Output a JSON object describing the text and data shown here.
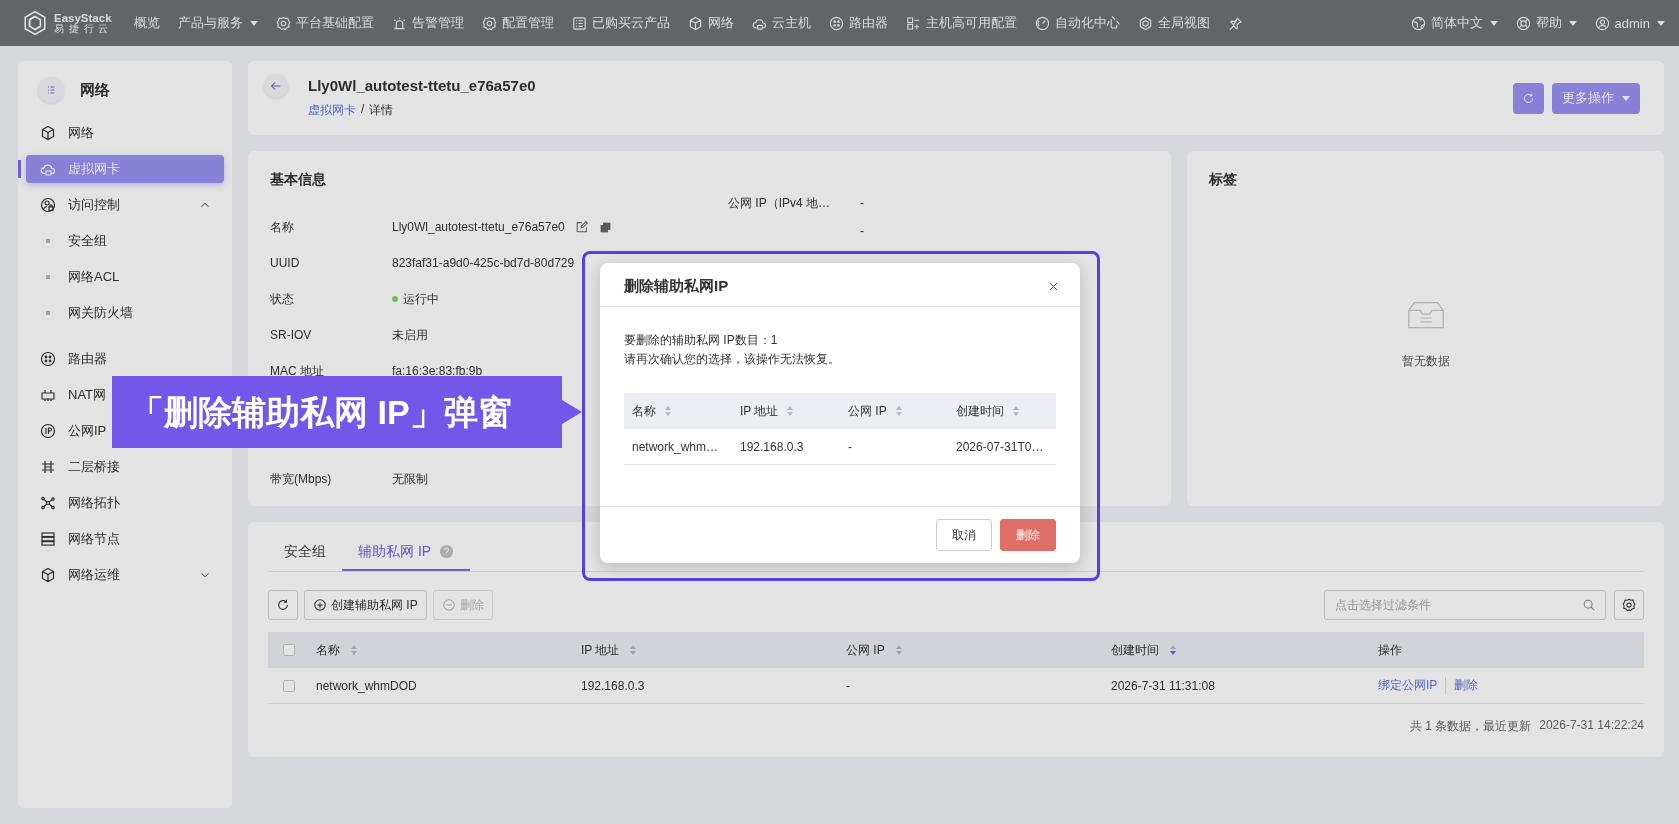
{
  "top_bar": {
    "logo": {
      "name": "EasyStack",
      "subtitle": "易 捷 行 云"
    },
    "nav": [
      {
        "label": "概览",
        "dropdown": false
      },
      {
        "label": "产品与服务",
        "dropdown": true
      },
      {
        "label": "平台基础配置",
        "dropdown": false
      },
      {
        "label": "告警管理",
        "dropdown": false
      },
      {
        "label": "配置管理",
        "dropdown": false
      },
      {
        "label": "已购买云产品",
        "dropdown": false
      },
      {
        "label": "网络",
        "dropdown": false
      },
      {
        "label": "云主机",
        "dropdown": false
      },
      {
        "label": "路由器",
        "dropdown": false
      },
      {
        "label": "主机高可用配置",
        "dropdown": false
      },
      {
        "label": "自动化中心",
        "dropdown": false
      },
      {
        "label": "全局视图",
        "dropdown": false
      }
    ],
    "right": [
      {
        "label": "简体中文",
        "dropdown": true
      },
      {
        "label": "帮助",
        "dropdown": true
      },
      {
        "label": "admin",
        "dropdown": true
      }
    ]
  },
  "sidebar": {
    "title": "网络",
    "items": [
      {
        "label": "网络",
        "selected": false
      },
      {
        "label": "虚拟网卡",
        "selected": true
      },
      {
        "label": "访问控制",
        "selected": false,
        "expanded": true,
        "children": [
          {
            "label": "安全组",
            "selected": false
          },
          {
            "label": "网络ACL",
            "selected": false
          },
          {
            "label": "网关防火墙",
            "selected": false
          }
        ]
      },
      {
        "label": "路由器",
        "selected": false
      },
      {
        "label": "NAT网",
        "selected": false
      },
      {
        "label": "公网IP",
        "selected": false
      },
      {
        "label": "二层桥接",
        "selected": false
      },
      {
        "label": "网络拓扑",
        "selected": false
      },
      {
        "label": "网络节点",
        "selected": false
      },
      {
        "label": "网络运维",
        "selected": false,
        "expanded": false
      }
    ]
  },
  "header": {
    "title": "Lly0Wl_autotest-ttetu_e76a57e0",
    "breadcrumb": [
      {
        "label": "虚拟网卡",
        "link": true
      },
      {
        "label": "详情",
        "link": false
      }
    ],
    "separator": "/",
    "more_button": "更多操作"
  },
  "basic_info": {
    "title": "基本信息",
    "fields": [
      {
        "label": "名称",
        "value": "Lly0Wl_autotest-ttetu_e76a57e0",
        "editable": true,
        "copyable": true
      },
      {
        "label": "UUID",
        "value": "823faf31-a9d0-425c-bd7d-80d729"
      },
      {
        "label": "状态",
        "value": "运行中",
        "color": "#6cc04a"
      },
      {
        "label": "SR-IOV",
        "value": "未启用"
      },
      {
        "label": "MAC 地址",
        "value": "fa:16:3e:83:fb:9b"
      },
      {
        "label": "带宽(Mbps)",
        "value": "无限制"
      }
    ],
    "side_fields": [
      {
        "label": "公网 IP（IPv4 地…",
        "value": "-"
      },
      {
        "value": "-"
      }
    ]
  },
  "tags": {
    "title": "标签",
    "empty_text": "暂无数据"
  },
  "detail_tabs": [
    {
      "label": "安全组",
      "selected": false,
      "help": false
    },
    {
      "label": "辅助私网 IP",
      "selected": true,
      "help": true
    }
  ],
  "toolbar": {
    "buttons": [
      {
        "label": "创建辅助私网 IP",
        "kind": "create",
        "disabled": false
      },
      {
        "label": "删除",
        "kind": "delete",
        "disabled": true
      }
    ],
    "filter_placeholder": "点击选择过滤条件"
  },
  "table": {
    "all_checked": false,
    "columns": [
      {
        "label": "名称",
        "sorted": false
      },
      {
        "label": "IP 地址",
        "sorted": false
      },
      {
        "label": "公网 IP",
        "sorted": false
      },
      {
        "label": "创建时间",
        "sorted": true
      },
      {
        "label": "操作"
      }
    ],
    "rows": [
      {
        "checked": false,
        "cells": [
          "network_whmDOD",
          "192.168.0.3",
          "-",
          "2026-7-31 11:31:08"
        ],
        "actions": [
          "绑定公网IP",
          "删除"
        ]
      }
    ],
    "footer": {
      "summary": "共 1 条数据，最近更新",
      "updated": "2026-7-31 14:22:24"
    }
  },
  "modal": {
    "title": "删除辅助私网IP",
    "lines": [
      "要删除的辅助私网 IP数目：1",
      "请再次确认您的选择，该操作无法恢复。"
    ],
    "columns": [
      {
        "label": "名称",
        "sorted": false
      },
      {
        "label": "IP 地址",
        "sorted": false
      },
      {
        "label": "公网 IP",
        "sorted": false
      },
      {
        "label": "创建时间",
        "sorted": false
      }
    ],
    "rows": [
      [
        "network_whm…",
        "192.168.0.3",
        "-",
        "2026-07-31T0…"
      ]
    ],
    "buttons": [
      {
        "label": "取消",
        "kind": "default"
      },
      {
        "label": "删除",
        "kind": "danger"
      }
    ]
  },
  "callout": {
    "text": "「删除辅助私网 IP」弹窗"
  }
}
